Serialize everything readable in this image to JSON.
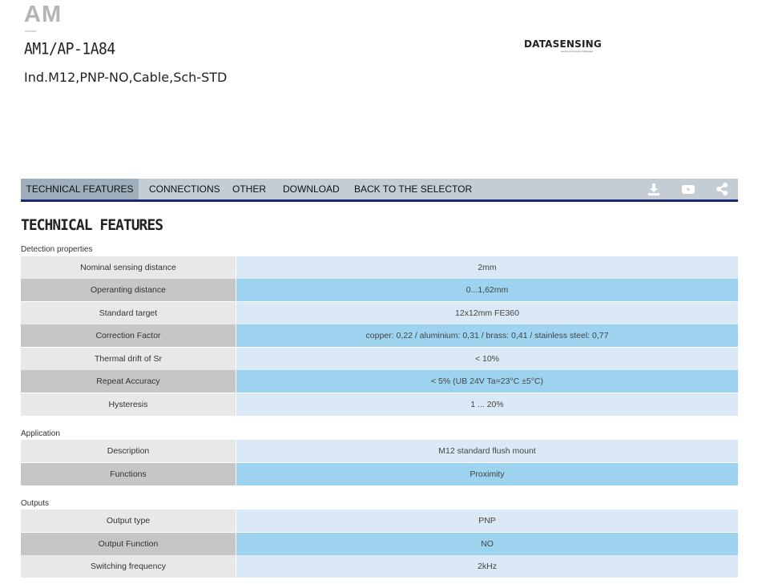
{
  "header": {
    "brand": "AM",
    "model": "AM1/AP-1A84",
    "description": "Ind.M12,PNP-NO,Cable,Sch-STD",
    "logo_text": "DATASENSING",
    "logo_tagline": "seeing and solving challenges"
  },
  "tabs": [
    {
      "label": "TECHNICAL FEATURES",
      "active": true
    },
    {
      "label": "CONNECTIONS"
    },
    {
      "label": "OTHER"
    },
    {
      "label": "DOWNLOAD"
    },
    {
      "label": "BACK TO THE SELECTOR"
    }
  ],
  "toolbar_icons": [
    "download-icon",
    "youtube-icon",
    "share-icon"
  ],
  "section_title": "TECHNICAL FEATURES",
  "groups": [
    {
      "title": "Detection properties",
      "rows": [
        {
          "label": "Nominal sensing distance",
          "value": "2mm"
        },
        {
          "label": "Operanting distance",
          "value": "0...1,62mm"
        },
        {
          "label": "Standard target",
          "value": "12x12mm FE360"
        },
        {
          "label": "Correction Factor",
          "value": "copper: 0,22 / aluminium: 0,31 / brass: 0,41 / stainless steel: 0,77"
        },
        {
          "label": "Thermal drift of Sr",
          "value": "< 10%"
        },
        {
          "label": "Repeat Accuracy",
          "value": "< 5% (UB 24V Ta=23°C ±5°C)"
        },
        {
          "label": "Hysteresis",
          "value": "1 ... 20%"
        }
      ]
    },
    {
      "title": "Application",
      "rows": [
        {
          "label": "Description",
          "value": "M12 standard flush mount"
        },
        {
          "label": "Functions",
          "value": "Proximity"
        }
      ]
    },
    {
      "title": "Outputs",
      "rows": [
        {
          "label": "Output type",
          "value": "PNP"
        },
        {
          "label": "Output Function",
          "value": "NO"
        },
        {
          "label": "Switching frequency",
          "value": "2kHz"
        }
      ]
    }
  ],
  "colors": {
    "accent_line": "#1e2a6e",
    "tabbar_bg": "#c4ccd4",
    "tab_active_bg": "#9faebb",
    "label_light": "#e8e8e8",
    "label_dark": "#c6c6c6",
    "value_light": "#dbe8f5",
    "value_dark": "#9dd3ef"
  }
}
